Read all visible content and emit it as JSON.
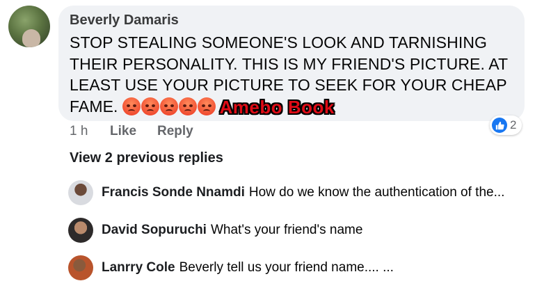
{
  "comment": {
    "author": "Beverly Damaris",
    "text": "STOP STEALING SOMEONE'S LOOK AND TARNISHING THEIR PERSONALITY. THIS IS MY FRIEND'S PICTURE. AT LEAST USE YOUR PICTURE TO SEEK FOR YOUR CHEAP FAME.",
    "emoji_icons": [
      "angry-face-icon",
      "angry-face-icon",
      "angry-face-icon",
      "angry-face-icon",
      "angry-face-icon"
    ],
    "watermark": "Amebo Book",
    "time": "1 h",
    "like_label": "Like",
    "reply_label": "Reply",
    "reaction_count": "2",
    "reaction_icon": "like-icon"
  },
  "view_previous": "View 2 previous replies",
  "replies": [
    {
      "author": "Francis Sonde Nnamdi",
      "text": "How do we know the authentication of the..."
    },
    {
      "author": "David Sopuruchi",
      "text": "What's your friend's name"
    },
    {
      "author": "Lanrry Cole",
      "text": "Beverly tell us your friend name.... ..."
    }
  ],
  "colors": {
    "bubble": "#f0f2f5",
    "like_blue": "#1877f2",
    "watermark_red": "#e00b16",
    "meta_gray": "#65676b"
  }
}
